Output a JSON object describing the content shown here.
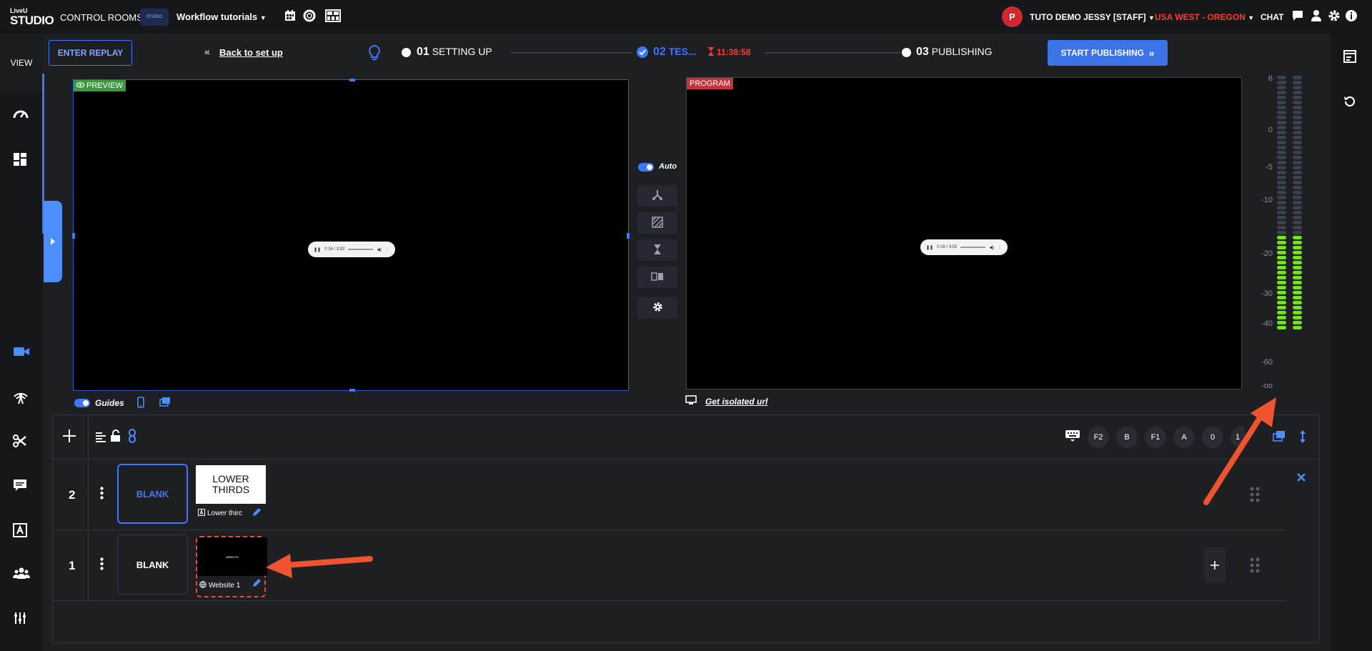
{
  "app": {
    "logo_top": "LiveU",
    "logo_bottom": "STUDIO"
  },
  "header": {
    "control_rooms": "CONTROL ROOMS",
    "workspace_thumb": "STUDIO",
    "workspace": "Workflow tutorials",
    "user_initial": "P",
    "user_name": "TUTO DEMO JESSY [STAFF]",
    "region": "USA WEST - OREGON",
    "chat": "CHAT"
  },
  "sidebar": {
    "view": "VIEW",
    "items": [
      "dashboard-icon",
      "layout-icon",
      "camera-icon",
      "broadcast-icon",
      "scissors-icon",
      "captions-icon",
      "text-icon",
      "guests-icon",
      "mixer-icon"
    ]
  },
  "toolbar": {
    "enter_replay": "ENTER REPLAY",
    "back": "Back to set up",
    "step1_num": "01",
    "step1_label": "SETTING UP",
    "step2_num": "02",
    "step2_label": "TES...",
    "timer": "11:38:58",
    "step3_num": "03",
    "step3_label": "PUBLISHING",
    "start_publishing": "START PUBLISHING"
  },
  "preview": {
    "label": "PREVIEW",
    "audio_time": "0:16 / 3:02",
    "guides": "Guides"
  },
  "program": {
    "label": "PROGRAM",
    "audio_time": "0:16 / 3:02",
    "isolated": "Get isolated url"
  },
  "transitions": {
    "auto": "Auto"
  },
  "meter": {
    "labels": [
      "6",
      "0",
      "-5",
      "-10",
      "-20",
      "-30",
      "-40",
      "-60",
      "-oo"
    ]
  },
  "layers": {
    "shortcuts": [
      "F2",
      "B",
      "F1",
      "A",
      "0",
      "1"
    ],
    "rows": [
      {
        "num": "2",
        "blank": "BLANK",
        "thumb_line1": "LOWER",
        "thumb_line2": "THIRDS",
        "caption": "Lower thirc"
      },
      {
        "num": "1",
        "blank": "BLANK",
        "thumb_text": "WEBSITE",
        "caption": "Website 1"
      }
    ]
  },
  "colors": {
    "accent": "#3b78ff",
    "publish": "#3c74e8",
    "region": "#ff3b1f",
    "timer": "#ff3b3b",
    "meter_on": "#74e21a",
    "annotation": "#f0532f"
  }
}
